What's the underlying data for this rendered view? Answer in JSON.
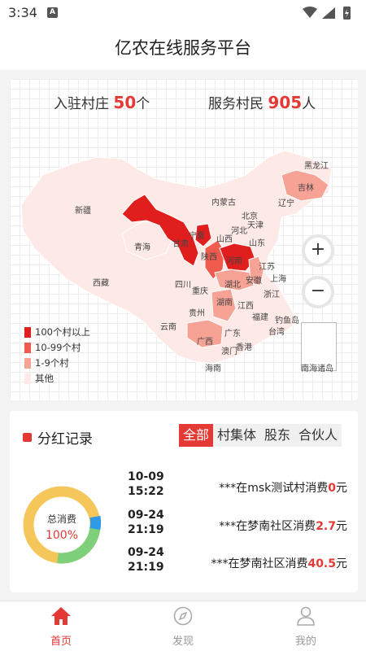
{
  "status_bar": {
    "time": "3:34",
    "notif_letter": "A"
  },
  "header": {
    "title": "亿农在线服务平台"
  },
  "stats": {
    "villages_label": "入驻村庄",
    "villages_value": "50",
    "villages_unit": "个",
    "residents_label": "服务村民",
    "residents_value": "905",
    "residents_unit": "人"
  },
  "map": {
    "provinces": [
      "新疆",
      "西藏",
      "青海",
      "甘肃",
      "宁夏",
      "内蒙古",
      "黑龙江",
      "吉林",
      "辽宁",
      "北京",
      "天津",
      "河北",
      "山西",
      "山东",
      "陕西",
      "河南",
      "江苏",
      "安徽",
      "上海",
      "四川",
      "重庆",
      "湖北",
      "浙江",
      "湖南",
      "江西",
      "贵州",
      "福建",
      "云南",
      "广西",
      "广东",
      "台湾",
      "澳门",
      "香港",
      "海南",
      "南海诸岛",
      "钓鱼岛"
    ],
    "highlighted": {
      "100+": [
        "甘肃",
        "宁夏",
        "河南"
      ],
      "10-99": [
        "青海",
        "陕西",
        "湖北",
        "安徽",
        "湖南",
        "广西",
        "吉林"
      ],
      "1-9": []
    },
    "zoom_in": "+",
    "zoom_out": "−"
  },
  "legend": [
    {
      "label": "100个村以上",
      "color": "#e01e1e"
    },
    {
      "label": "10-99个村",
      "color": "#ef5b4d"
    },
    {
      "label": "1-9个村",
      "color": "#f6a396"
    },
    {
      "label": "其他",
      "color": "#fde9e6"
    }
  ],
  "colors": {
    "accent": "#e53935",
    "other_region": "#fde9e6"
  },
  "dividend": {
    "title": "分红记录",
    "tabs": [
      "全部",
      "村集体",
      "股东",
      "合伙人"
    ],
    "active_tab": "全部",
    "donut_label": "总消费",
    "donut_pct": "100%",
    "records": [
      {
        "date": "10-09",
        "time": "15:22",
        "text": "***在msk测试村消费",
        "amount": "0",
        "unit": "元"
      },
      {
        "date": "09-24",
        "time": "21:19",
        "text": "***在梦南社区消费",
        "amount": "2.7",
        "unit": "元"
      },
      {
        "date": "09-24",
        "time": "21:19",
        "text": "***在梦南社区消费",
        "amount": "40.5",
        "unit": "元"
      }
    ]
  },
  "nav": [
    {
      "label": "首页",
      "icon": "home-icon",
      "active": true
    },
    {
      "label": "发现",
      "icon": "compass-icon",
      "active": false
    },
    {
      "label": "我的",
      "icon": "user-icon",
      "active": false
    }
  ]
}
